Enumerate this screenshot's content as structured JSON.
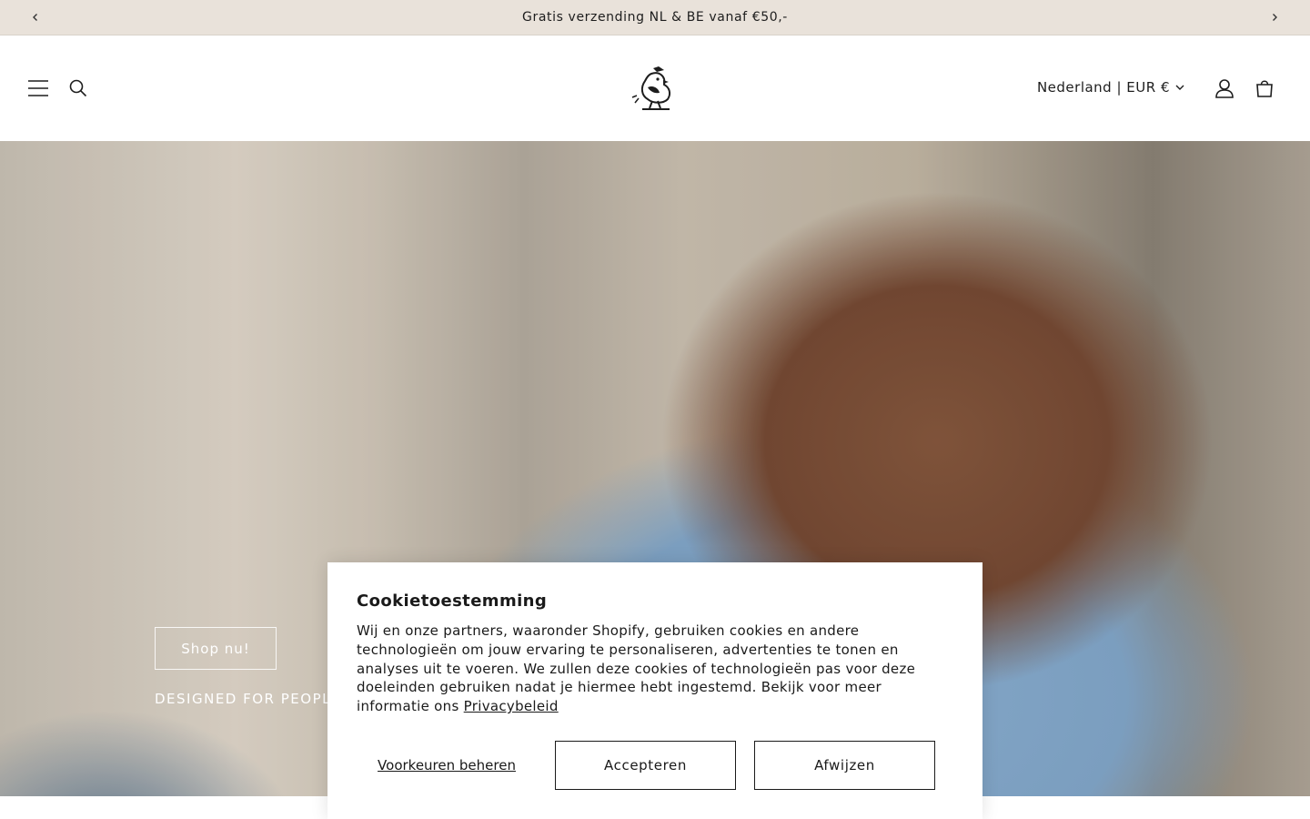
{
  "announcement": {
    "text": "Gratis verzending NL & BE vanaf €50,-",
    "prev_icon": "chevron-left-icon",
    "next_icon": "chevron-right-icon"
  },
  "header": {
    "menu_icon": "hamburger-menu-icon",
    "search_icon": "search-icon",
    "logo_icon": "bird-logo-icon",
    "locale_label": "Nederland | EUR €",
    "account_icon": "account-icon",
    "cart_icon": "cart-icon"
  },
  "hero": {
    "button_label": "Shop nu!",
    "subtitle": "DESIGNED FOR PEOPLE"
  },
  "cookie": {
    "title": "Cookietoestemming",
    "body": "Wij en onze partners, waaronder Shopify, gebruiken cookies en andere technologieën om jouw ervaring te personaliseren, advertenties te tonen en analyses uit te voeren. We zullen deze cookies of technologieën pas voor deze doeleinden gebruiken nadat je hiermee hebt ingestemd. Bekijk voor meer informatie ons",
    "link_label": "Privacybeleid",
    "preferences_label": "Voorkeuren beheren",
    "accept_label": "Accepteren",
    "decline_label": "Afwijzen"
  },
  "colors": {
    "announcement_bg": "#e9e2da",
    "text": "#121212",
    "banner_bg": "#ffffff"
  }
}
